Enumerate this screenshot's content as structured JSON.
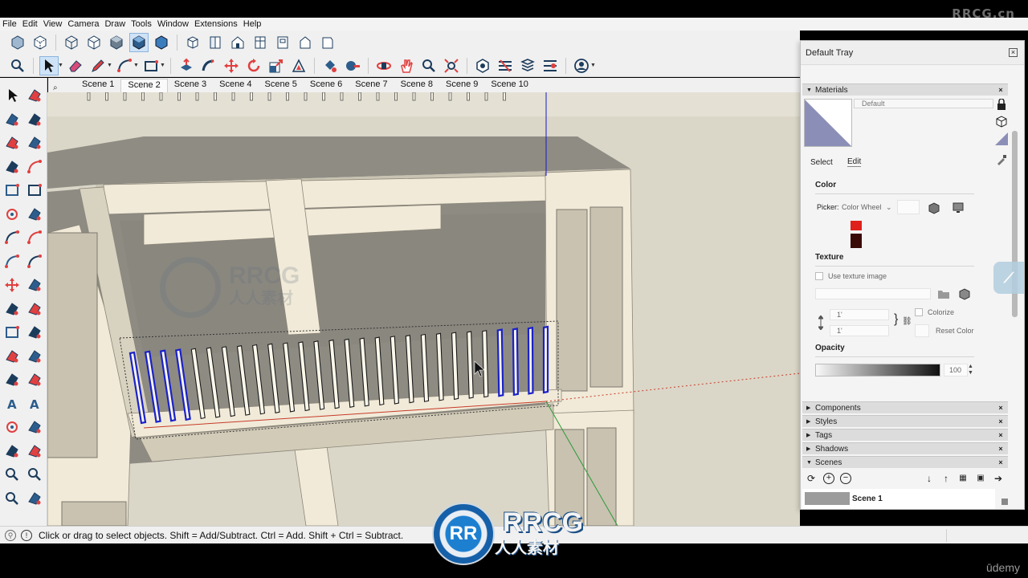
{
  "watermark_top": "RRCG.cn",
  "menubar": {
    "items": [
      "File",
      "Edit",
      "View",
      "Camera",
      "Draw",
      "Tools",
      "Window",
      "Extensions",
      "Help"
    ]
  },
  "toolbar1": {
    "icons": [
      "xray-style-icon",
      "back-edges-style-icon",
      "wireframe-style-icon",
      "hidden-line-style-icon",
      "shaded-style-icon",
      "shaded-textures-style-icon",
      "monochrome-style-icon",
      "iso-view-icon",
      "top-view-icon",
      "front-view-icon",
      "right-view-icon",
      "back-view-icon",
      "left-view-icon",
      "bottom-view-icon"
    ]
  },
  "toolbar2": {
    "icons": [
      "search-icon",
      "select-arrow-icon",
      "eraser-icon",
      "pencil-icon",
      "arc-icon",
      "rectangle-icon",
      "push-pull-icon",
      "follow-me-icon",
      "move-icon",
      "rotate-icon",
      "scale-icon",
      "offset-icon",
      "paint-bucket-icon",
      "tape-measure-icon",
      "orbit-icon",
      "pan-icon",
      "zoom-icon",
      "zoom-extents-icon",
      "warehouse-icon",
      "extension-warehouse-icon",
      "layout-icon",
      "sketchup-account-icon"
    ]
  },
  "scenes": {
    "tabs": [
      "Scene 1",
      "Scene 2",
      "Scene 3",
      "Scene 4",
      "Scene 5",
      "Scene 6",
      "Scene 7",
      "Scene 8",
      "Scene 9",
      "Scene 10"
    ],
    "active": "Scene 2"
  },
  "leftbar": {
    "icons": [
      "select-icon",
      "lasso-select-icon",
      "paint-bucket-icon",
      "eraser-icon",
      "make-component-icon",
      "tag-eraser-icon",
      "line-icon",
      "freehand-icon",
      "rectangle-icon",
      "rotated-rectangle-icon",
      "circle-icon",
      "polygon-icon",
      "arc-icon",
      "two-point-arc-icon",
      "three-point-arc-icon",
      "pie-icon",
      "move-icon",
      "push-pull-icon",
      "rotate-icon",
      "follow-me-icon",
      "scale-icon",
      "offset-icon",
      "axes-icon",
      "protractor-icon",
      "tape-measure-icon",
      "dimension-icon",
      "text-icon",
      "3d-text-icon",
      "orbit-icon",
      "walk-icon",
      "section-plane-icon",
      "position-camera-icon",
      "zoom-icon",
      "zoom-window-icon",
      "zoom-extents-icon",
      "look-around-icon"
    ]
  },
  "viewport": {
    "watermark_brand": "RRCG",
    "watermark_sub": "人人素材"
  },
  "status": {
    "text": "Click or drag to select objects. Shift = Add/Subtract. Ctrl = Add. Shift + Ctrl = Subtract."
  },
  "watermark_bottom": {
    "brand": "RRCG",
    "sub": "人人素材",
    "logo": "RR"
  },
  "udemy": "ūdemy",
  "tray": {
    "title": "Default Tray",
    "materials": {
      "heading": "Materials",
      "name": "Default",
      "tabs": [
        "Select",
        "Edit"
      ],
      "color_label": "Color",
      "picker_label": "Picker:",
      "picker_value": "Color Wheel",
      "texture_label": "Texture",
      "use_texture": "Use texture image",
      "size_w": "1'",
      "size_h": "1'",
      "colorize": "Colorize",
      "reset_color": "Reset Color",
      "opacity_label": "Opacity",
      "opacity_value": "100",
      "swatch_colors": [
        "#e0201a",
        "#3a0a08"
      ]
    },
    "panels": [
      "Components",
      "Styles",
      "Tags",
      "Shadows",
      "Scenes"
    ],
    "scene_list": {
      "first": "Scene 1"
    }
  },
  "colors": {
    "selection_blue": "#1a22c8",
    "axis_red": "#c83a2a",
    "axis_green": "#2a9a3a",
    "axis_blue": "#1a1ac8",
    "wall": "#f1ead8",
    "shadow": "#8f8c84"
  }
}
